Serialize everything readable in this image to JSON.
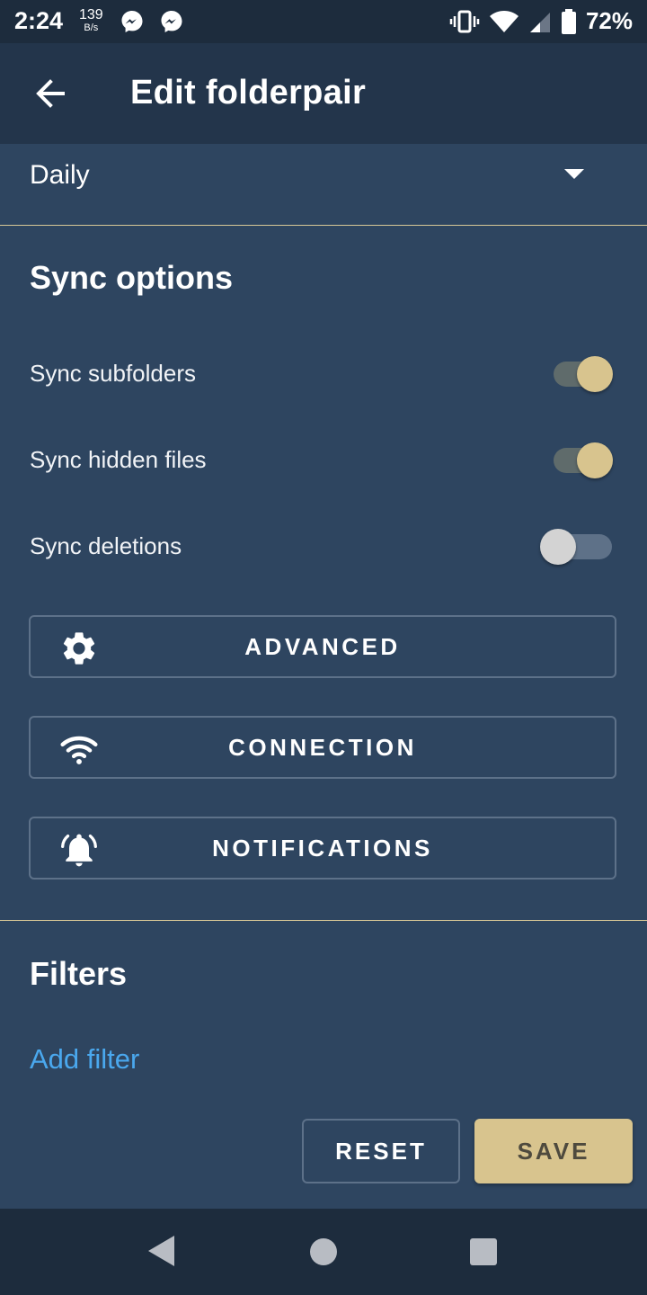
{
  "status_bar": {
    "time": "2:24",
    "speed_value": "139",
    "speed_unit": "B/s",
    "icons": [
      "messenger-icon",
      "messenger-icon",
      "vibrate-icon",
      "wifi-icon",
      "cell-signal-icon",
      "battery-icon"
    ],
    "battery_percent": "72%"
  },
  "app_bar": {
    "title": "Edit folderpair",
    "back_icon": "arrow-left-icon"
  },
  "schedule": {
    "selected": "Daily"
  },
  "sync_options": {
    "title": "Sync options",
    "toggles": [
      {
        "label": "Sync subfolders",
        "on": true
      },
      {
        "label": "Sync hidden files",
        "on": true
      },
      {
        "label": "Sync deletions",
        "on": false
      }
    ],
    "buttons": [
      {
        "label": "ADVANCED",
        "icon": "gear-icon"
      },
      {
        "label": "CONNECTION",
        "icon": "wifi-icon"
      },
      {
        "label": "NOTIFICATIONS",
        "icon": "bell-ringing-icon"
      }
    ]
  },
  "filters": {
    "title": "Filters",
    "add_label": "Add filter"
  },
  "actions": {
    "reset_label": "RESET",
    "save_label": "SAVE"
  },
  "colors": {
    "background": "#2e4560",
    "app_bar": "#23354b",
    "accent": "#d8c48e",
    "link": "#4aa8ee"
  },
  "nav_bar": {
    "icons": [
      "nav-back-icon",
      "nav-home-icon",
      "nav-recents-icon"
    ]
  }
}
